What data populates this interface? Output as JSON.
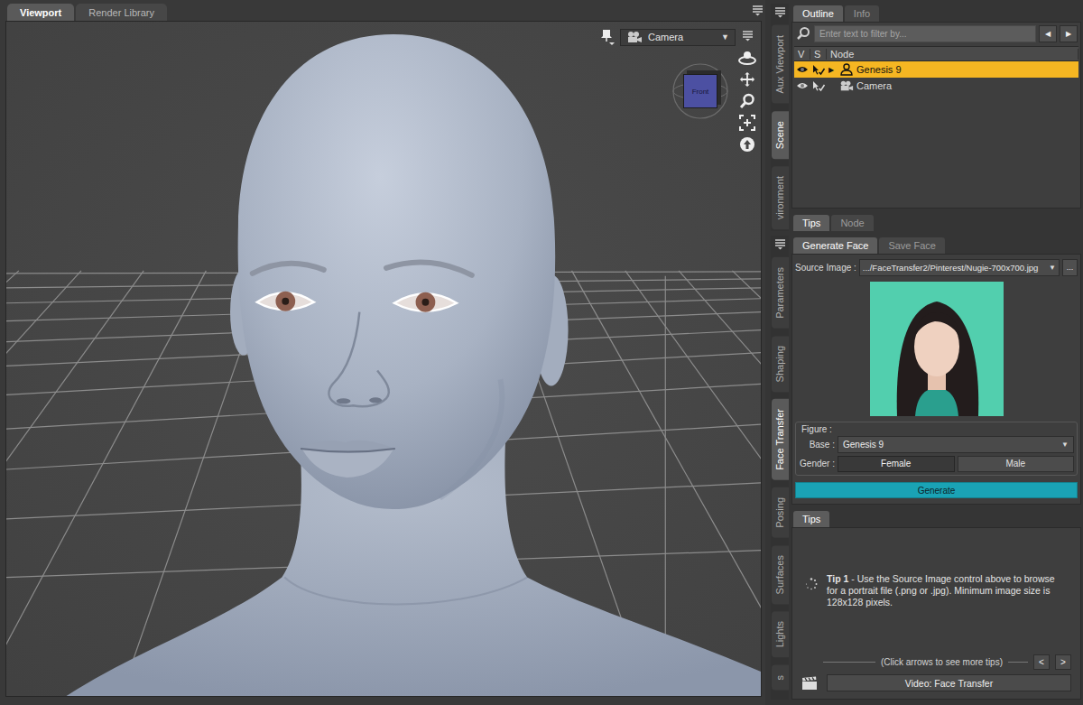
{
  "viewport_tabs": [
    {
      "label": "Viewport",
      "selected": true
    },
    {
      "label": "Render Library",
      "selected": false
    }
  ],
  "viewport": {
    "camera_dropdown": "Camera",
    "camera_arrow": "▼",
    "view_cube": "Front"
  },
  "scene_side_tabs": [
    {
      "label": "Aux Viewport",
      "selected": false
    },
    {
      "label": "Scene",
      "selected": true
    },
    {
      "label": "vironment",
      "selected": false
    }
  ],
  "outline": {
    "tabs": [
      {
        "label": "Outline",
        "selected": true
      },
      {
        "label": "Info",
        "selected": false
      }
    ],
    "search": {
      "placeholder": "Enter text to filter by..."
    },
    "nav": [
      "◀",
      "▶"
    ],
    "columns": [
      "V",
      "S",
      "Node"
    ],
    "rows": [
      {
        "node": "Genesis 9",
        "selected": true,
        "expander": "▶",
        "kind": "figure"
      },
      {
        "node": "Camera",
        "selected": false,
        "kind": "camera"
      }
    ]
  },
  "node_tabs": [
    {
      "label": "Tips",
      "selected": true
    },
    {
      "label": "Node",
      "selected": false
    }
  ],
  "pane_side_tabs": [
    {
      "label": "Parameters",
      "selected": false
    },
    {
      "label": "Shaping",
      "selected": false
    },
    {
      "label": "Face Transfer",
      "selected": true
    },
    {
      "label": "Posing",
      "selected": false
    },
    {
      "label": "Surfaces",
      "selected": false
    },
    {
      "label": "Lights",
      "selected": false
    },
    {
      "label": "s",
      "selected": false
    }
  ],
  "face_transfer": {
    "tabs": [
      {
        "label": "Generate Face",
        "selected": true
      },
      {
        "label": "Save Face",
        "selected": false
      }
    ],
    "source_label": "Source Image :",
    "source_value": ".../FaceTransfer2/Pinterest/Nugie-700x700.jpg",
    "source_arrow": "▼",
    "browse": "...",
    "figure_label": "Figure :",
    "base_label": "Base :",
    "base_value": "Genesis 9",
    "base_arrow": "▼",
    "gender_label": "Gender :",
    "genders": [
      {
        "label": "Female",
        "selected": true
      },
      {
        "label": "Male",
        "selected": false
      }
    ],
    "generate": "Generate"
  },
  "tips": {
    "tabs": [
      {
        "label": "Tips",
        "selected": true
      }
    ],
    "tip_title": "Tip 1",
    "tip_text": "- Use the Source Image control above to browse for a portrait file (.png or .jpg). Minimum image size is 128x128 pixels.",
    "hint": "(Click arrows to see more tips)",
    "prev": "<",
    "next": ">",
    "video": "Video: Face Transfer"
  }
}
